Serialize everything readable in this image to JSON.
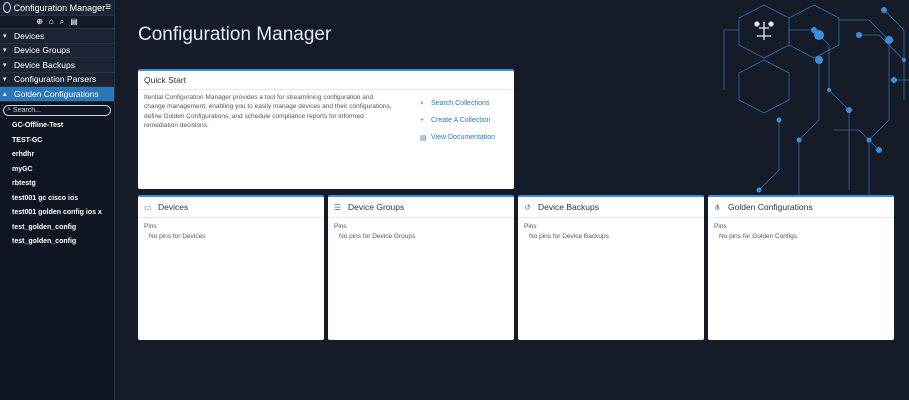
{
  "sidebar": {
    "title": "Configuration Manager",
    "nav_items": [
      {
        "label": "Devices"
      },
      {
        "label": "Device Groups"
      },
      {
        "label": "Device Backups"
      },
      {
        "label": "Configuration Parsers"
      },
      {
        "label": "Golden Configurations"
      }
    ],
    "search_placeholder": "Search...",
    "golden_configs": [
      "GC-Offline-Test",
      "TEST-GC",
      "erhdhr",
      "myGC",
      "rbtestg",
      "test001 gc cisco ios",
      "test001 golden config ios x",
      "test_golden_config",
      "test_golden_config"
    ]
  },
  "main": {
    "title": "Configuration Manager",
    "quick_start": {
      "title": "Quick Start",
      "description": "Itential Configuration Manager provides a tool for streamlining configuration and change management, enabling you to easily manage devices and their configurations, define Golden Configurations, and schedule compliance reports for informed remediation decisions.",
      "links": [
        {
          "label": "Search Collections",
          "icon": "search-icon"
        },
        {
          "label": "Create A Collection",
          "icon": "plus-icon"
        },
        {
          "label": "View Documentation",
          "icon": "document-icon"
        }
      ]
    },
    "pin_cards": [
      {
        "title": "Devices",
        "pins_label": "Pins",
        "empty": "No pins for Devices",
        "icon": "devices-icon"
      },
      {
        "title": "Device Groups",
        "pins_label": "Pins",
        "empty": "No pins for Device Groups",
        "icon": "list-icon"
      },
      {
        "title": "Device Backups",
        "pins_label": "Pins",
        "empty": "No pins for Device Backups",
        "icon": "history-icon"
      },
      {
        "title": "Golden Configurations",
        "pins_label": "Pins",
        "empty": "No pins for Golden Configs",
        "icon": "tree-icon"
      }
    ]
  },
  "colors": {
    "background": "#151b27",
    "sidebar": "#0f1622",
    "accent": "#2a78b8",
    "card": "#ffffff"
  }
}
